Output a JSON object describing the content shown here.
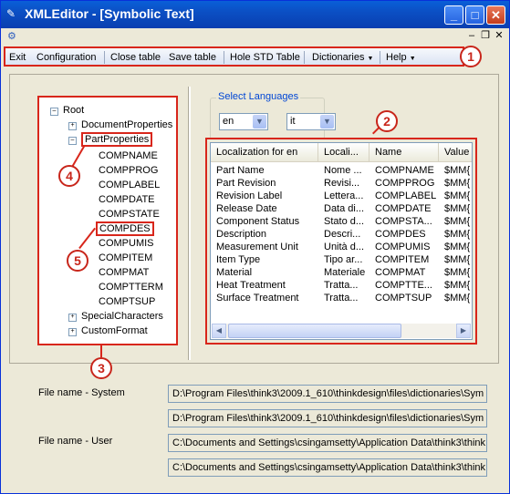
{
  "window": {
    "title": "XMLEditor - [Symbolic Text]",
    "title_buttons": [
      "minimize",
      "maximize",
      "close"
    ]
  },
  "menu": {
    "items": [
      {
        "label": "Exit"
      },
      {
        "label": "Configuration"
      },
      {
        "label": "Close table"
      },
      {
        "label": "Save table"
      },
      {
        "label": "Hole STD Table"
      },
      {
        "label": "Dictionaries",
        "dropdown": true
      },
      {
        "label": "Help",
        "dropdown": true
      }
    ]
  },
  "callouts": [
    "1",
    "2",
    "3",
    "4",
    "5"
  ],
  "tree": {
    "root": "Root",
    "nodes": [
      {
        "label": "DocumentProperties",
        "expander": "+"
      },
      {
        "label": "PartProperties",
        "expander": "-"
      }
    ],
    "children": [
      "COMPNAME",
      "COMPPROG",
      "COMPLABEL",
      "COMPDATE",
      "COMPSTATE",
      "COMPDES",
      "COMPUMIS",
      "COMPITEM",
      "COMPMAT",
      "COMPTTERM",
      "COMPTSUP"
    ],
    "after": [
      {
        "label": "SpecialCharacters",
        "expander": "+"
      },
      {
        "label": "CustomFormat",
        "expander": "+"
      }
    ]
  },
  "languages": {
    "label": "Select Languages",
    "lang1": "en",
    "lang2": "it"
  },
  "grid": {
    "headers": [
      "Localization for    en",
      "Locali...",
      "Name",
      "Value"
    ],
    "rows": [
      [
        "Part Name",
        "Nome ...",
        "COMPNAME",
        "$MM{"
      ],
      [
        "Part Revision",
        "Revisi...",
        "COMPPROG",
        "$MM{"
      ],
      [
        "Revision Label",
        "Lettera...",
        "COMPLABEL",
        "$MM{"
      ],
      [
        "Release Date",
        "Data di...",
        "COMPDATE",
        "$MM{"
      ],
      [
        "Component Status",
        "Stato d...",
        "COMPSTA...",
        "$MM{"
      ],
      [
        "Description",
        "Descri...",
        "COMPDES",
        "$MM{"
      ],
      [
        "Measurement Unit",
        "Unità d...",
        "COMPUMIS",
        "$MM{"
      ],
      [
        "Item Type",
        "Tipo ar...",
        "COMPITEM",
        "$MM{"
      ],
      [
        "Material",
        "Materiale",
        "COMPMAT",
        "$MM{"
      ],
      [
        "Heat Treatment",
        "Tratta...",
        "COMPTTE...",
        "$MM{"
      ],
      [
        "Surface Treatment",
        "Tratta...",
        "COMPTSUP",
        "$MM{"
      ]
    ]
  },
  "files": {
    "system_label": "File name - System",
    "system_1": "D:\\Program Files\\think3\\2009.1_610\\thinkdesign\\files\\dictionaries\\Sym",
    "system_2": "D:\\Program Files\\think3\\2009.1_610\\thinkdesign\\files\\dictionaries\\Sym",
    "user_label": "File name - User",
    "user_1": "C:\\Documents and Settings\\csingamsetty\\Application Data\\think3\\think",
    "user_2": "C:\\Documents and Settings\\csingamsetty\\Application Data\\think3\\think"
  },
  "colors": {
    "title_blue": "#0b4fc4",
    "annotation_red": "#d8261b",
    "group_label_blue": "#0046d5"
  }
}
